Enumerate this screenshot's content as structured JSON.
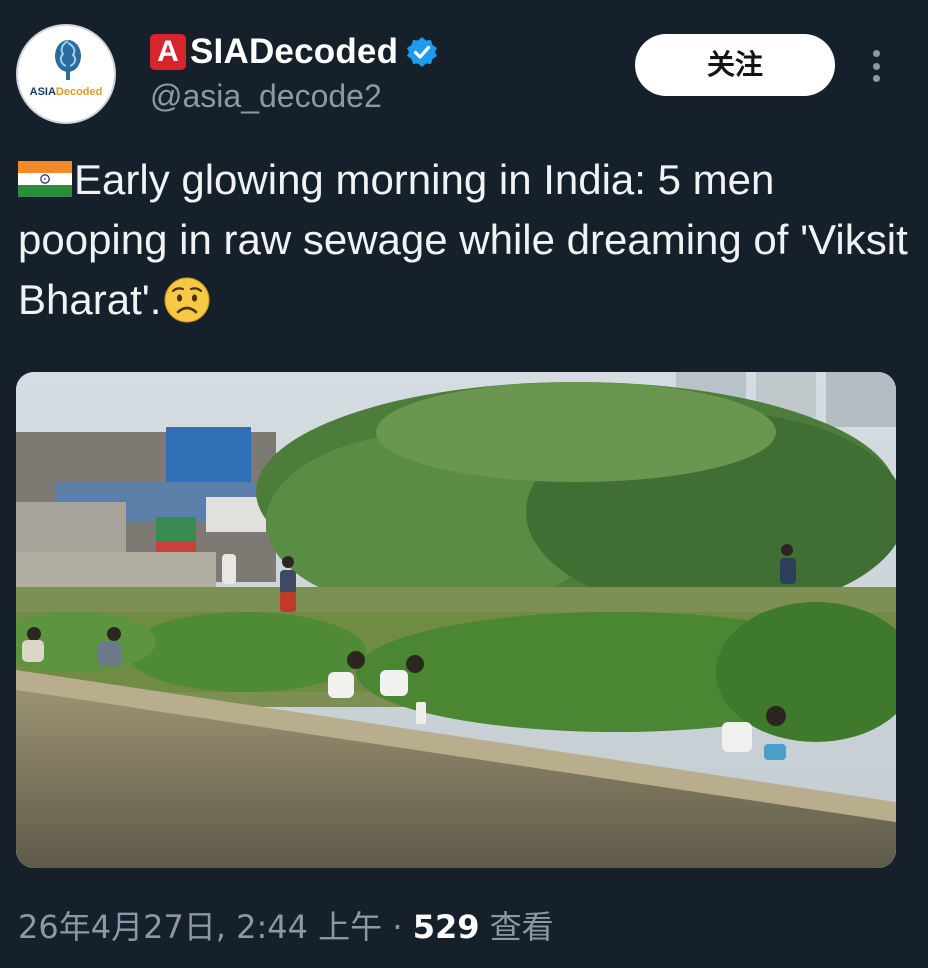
{
  "author": {
    "avatar_logo_text_main": "ASIA",
    "avatar_logo_text_accent": "Decoded",
    "brand_letter": "A",
    "display_name_rest": "SIADecoded",
    "handle": "@asia_decode2",
    "verified_icon": "verified-badge-icon"
  },
  "actions": {
    "follow_label": "关注",
    "more_icon": "more-dots-icon"
  },
  "tweet": {
    "flag_icon": "india-flag-icon",
    "text": "Early glowing morning in India: 5 men pooping in raw sewage while dreaming of 'Viksit Bharat'.",
    "emoji_icon": "worried-face-icon"
  },
  "meta": {
    "date": "26年4月27日, 2:44 上午",
    "separator": "·",
    "views_count": "529",
    "views_label": "查看"
  },
  "colors": {
    "background": "#16202b",
    "brand_red": "#d7262b",
    "verified_blue": "#1d9bf0",
    "secondary_text": "#8b98a5"
  }
}
